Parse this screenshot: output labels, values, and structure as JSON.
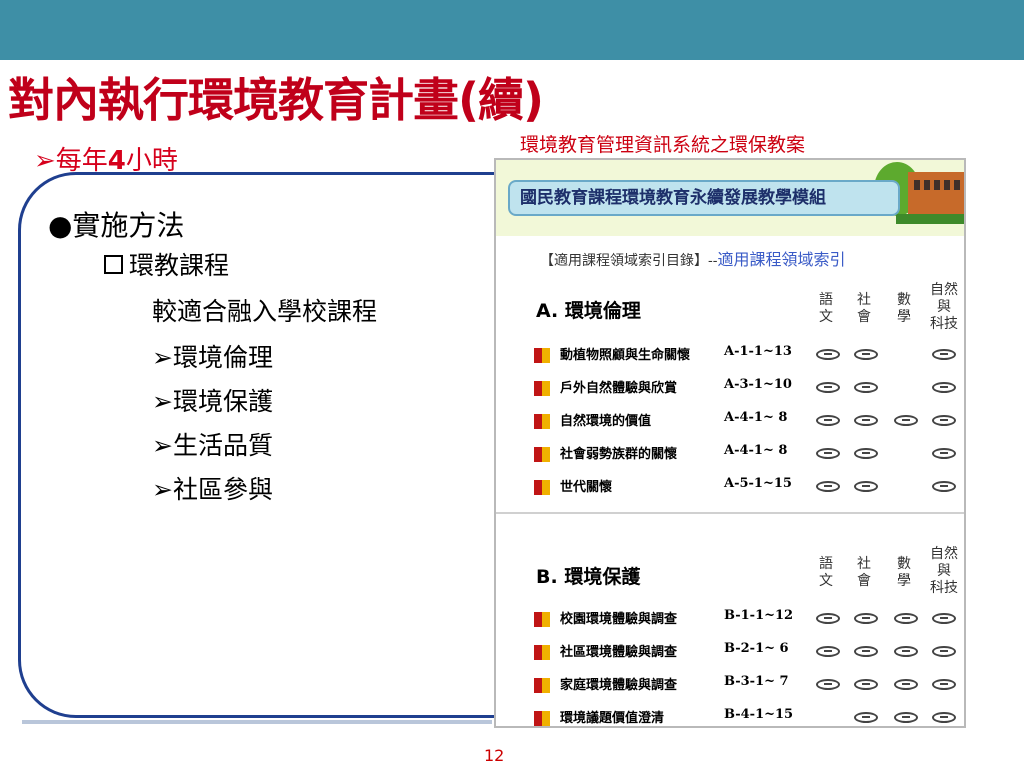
{
  "slide": {
    "title": "對內執行環境教育計畫(續)",
    "subpoint_prefix": "➢每年",
    "subpoint_bold": "4",
    "subpoint_suffix": "小時",
    "caption": "環境教育管理資訊系統之環保教案",
    "method": "●實施方法",
    "course": "環教課程",
    "description": "較適合融入學校課程",
    "topics": [
      "➢環境倫理",
      "➢環境保護",
      "➢生活品質",
      "➢社區參與"
    ],
    "page_number": "12"
  },
  "screenshot": {
    "banner": "國民教育課程環境教育永續發展教學模組",
    "index_label": "【適用課程領域索引目錄】--",
    "index_link": "適用課程領域索引",
    "subjects": {
      "chinese": [
        "語",
        "文"
      ],
      "social": [
        "社",
        "會"
      ],
      "math": [
        "數",
        "學"
      ],
      "science": [
        "自然",
        "與",
        "科技"
      ]
    },
    "sections": [
      {
        "heading": "A. 環境倫理",
        "rows": [
          {
            "label": "動植物照顧與生命關懷",
            "code": "A-1-1~13",
            "chinese": "smiley-icon",
            "social": "smiley-icon",
            "math": "",
            "science": "smiley-icon"
          },
          {
            "label": "戶外自然體驗與欣賞",
            "code": "A-3-1~10",
            "chinese": "smiley-icon",
            "social": "smiley-icon",
            "math": "",
            "science": "smiley-icon"
          },
          {
            "label": "自然環境的價值",
            "code": "A-4-1~ 8",
            "chinese": "smiley-icon",
            "social": "smiley-icon",
            "math": "smiley-icon",
            "science": "smiley-icon"
          },
          {
            "label": "社會弱勢族群的關懷",
            "code": "A-4-1~ 8",
            "chinese": "smiley-icon",
            "social": "smiley-icon",
            "math": "",
            "science": "smiley-icon"
          },
          {
            "label": "世代關懷",
            "code": "A-5-1~15",
            "chinese": "smiley-icon",
            "social": "smiley-icon",
            "math": "",
            "science": "smiley-icon"
          }
        ]
      },
      {
        "heading": "B. 環境保護",
        "rows": [
          {
            "label": "校園環境體驗與調查",
            "code": "B-1-1~12",
            "chinese": "smiley-icon",
            "social": "smiley-icon",
            "math": "smiley-icon",
            "science": "smiley-icon"
          },
          {
            "label": "社區環境體驗與調查",
            "code": "B-2-1~ 6",
            "chinese": "smiley-icon",
            "social": "smiley-icon",
            "math": "smiley-icon",
            "science": "smiley-icon"
          },
          {
            "label": "家庭環境體驗與調查",
            "code": "B-3-1~ 7",
            "chinese": "smiley-icon",
            "social": "smiley-icon",
            "math": "smiley-icon",
            "science": "smiley-icon"
          },
          {
            "label": "環境議題價值澄清",
            "code": "B-4-1~15",
            "chinese": "",
            "social": "smiley-icon",
            "math": "smiley-icon",
            "science": "smiley-icon"
          }
        ]
      }
    ]
  }
}
